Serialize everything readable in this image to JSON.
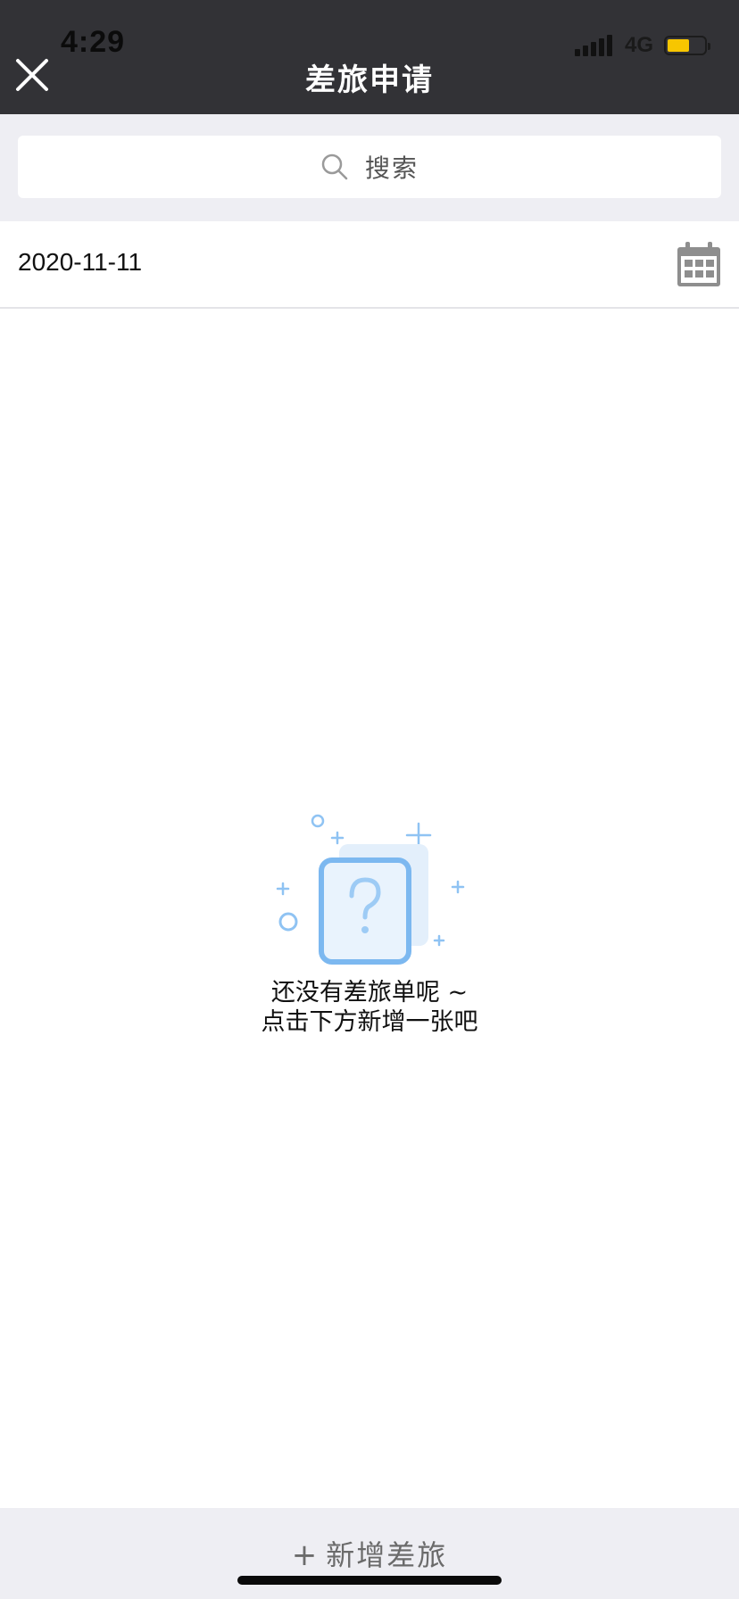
{
  "status_bar": {
    "time": "4:29",
    "network": "4G",
    "battery_level": 0.6,
    "battery_color": "#f7c600"
  },
  "header": {
    "title": "差旅申请",
    "close_icon": "close-icon"
  },
  "search": {
    "placeholder": "搜索",
    "icon": "search-icon"
  },
  "date_filter": {
    "value": "2020-11-11",
    "icon": "calendar-icon"
  },
  "empty_state": {
    "icon": "question-document-icon",
    "line1": "还没有差旅单呢 ~",
    "line2": "点击下方新增一张吧"
  },
  "footer": {
    "add_symbol": "+",
    "add_label": "新增差旅"
  },
  "colors": {
    "header_bg": "#323236",
    "page_bg": "#eeeef3",
    "accent_blue": "#7cb8f0"
  }
}
